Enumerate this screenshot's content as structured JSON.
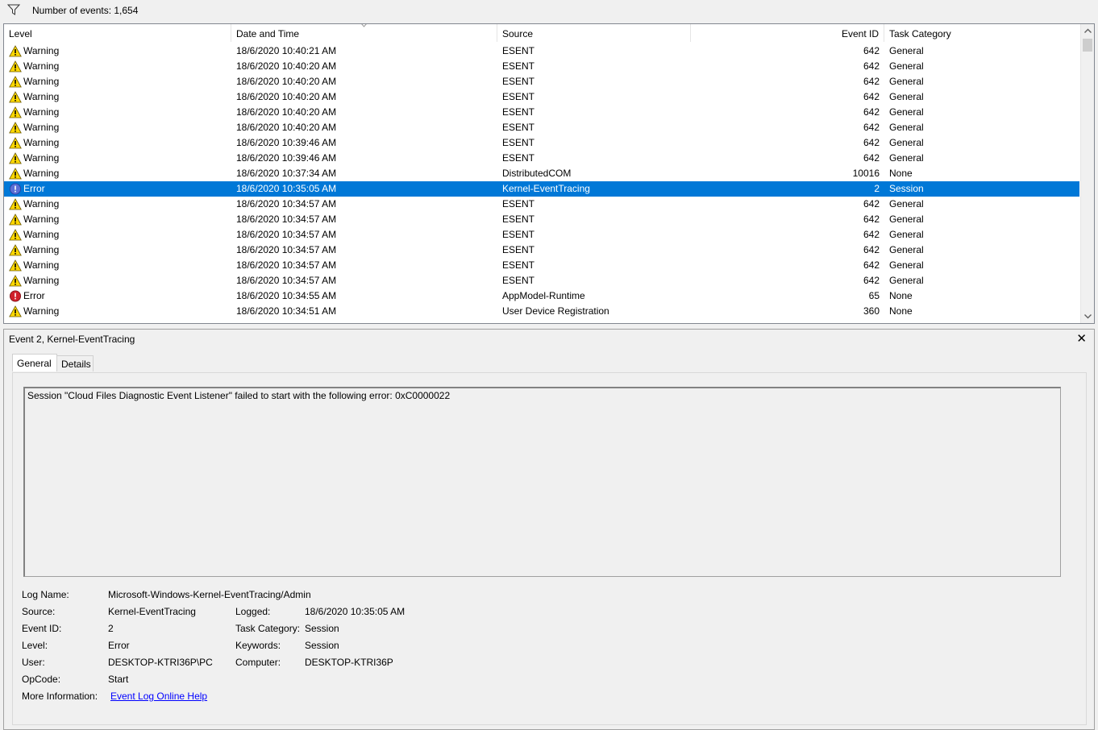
{
  "filter": {
    "count_text": "Number of events: 1,654"
  },
  "columns": {
    "level": "Level",
    "date": "Date and Time",
    "source": "Source",
    "event_id": "Event ID",
    "task_category": "Task Category"
  },
  "events": [
    {
      "level": "Warning",
      "date": "18/6/2020 10:40:21 AM",
      "source": "ESENT",
      "id": "642",
      "cat": "General"
    },
    {
      "level": "Warning",
      "date": "18/6/2020 10:40:20 AM",
      "source": "ESENT",
      "id": "642",
      "cat": "General"
    },
    {
      "level": "Warning",
      "date": "18/6/2020 10:40:20 AM",
      "source": "ESENT",
      "id": "642",
      "cat": "General"
    },
    {
      "level": "Warning",
      "date": "18/6/2020 10:40:20 AM",
      "source": "ESENT",
      "id": "642",
      "cat": "General"
    },
    {
      "level": "Warning",
      "date": "18/6/2020 10:40:20 AM",
      "source": "ESENT",
      "id": "642",
      "cat": "General"
    },
    {
      "level": "Warning",
      "date": "18/6/2020 10:40:20 AM",
      "source": "ESENT",
      "id": "642",
      "cat": "General"
    },
    {
      "level": "Warning",
      "date": "18/6/2020 10:39:46 AM",
      "source": "ESENT",
      "id": "642",
      "cat": "General"
    },
    {
      "level": "Warning",
      "date": "18/6/2020 10:39:46 AM",
      "source": "ESENT",
      "id": "642",
      "cat": "General"
    },
    {
      "level": "Warning",
      "date": "18/6/2020 10:37:34 AM",
      "source": "DistributedCOM",
      "id": "10016",
      "cat": "None"
    },
    {
      "level": "Error",
      "date": "18/6/2020 10:35:05 AM",
      "source": "Kernel-EventTracing",
      "id": "2",
      "cat": "Session",
      "selected": true
    },
    {
      "level": "Warning",
      "date": "18/6/2020 10:34:57 AM",
      "source": "ESENT",
      "id": "642",
      "cat": "General"
    },
    {
      "level": "Warning",
      "date": "18/6/2020 10:34:57 AM",
      "source": "ESENT",
      "id": "642",
      "cat": "General"
    },
    {
      "level": "Warning",
      "date": "18/6/2020 10:34:57 AM",
      "source": "ESENT",
      "id": "642",
      "cat": "General"
    },
    {
      "level": "Warning",
      "date": "18/6/2020 10:34:57 AM",
      "source": "ESENT",
      "id": "642",
      "cat": "General"
    },
    {
      "level": "Warning",
      "date": "18/6/2020 10:34:57 AM",
      "source": "ESENT",
      "id": "642",
      "cat": "General"
    },
    {
      "level": "Warning",
      "date": "18/6/2020 10:34:57 AM",
      "source": "ESENT",
      "id": "642",
      "cat": "General"
    },
    {
      "level": "Error",
      "date": "18/6/2020 10:34:55 AM",
      "source": "AppModel-Runtime",
      "id": "65",
      "cat": "None"
    },
    {
      "level": "Warning",
      "date": "18/6/2020 10:34:51 AM",
      "source": "User Device Registration",
      "id": "360",
      "cat": "None"
    }
  ],
  "detail": {
    "title": "Event 2, Kernel-EventTracing",
    "close": "✕",
    "tabs": {
      "general": "General",
      "details": "Details"
    },
    "message": "Session \"Cloud Files Diagnostic Event Listener\" failed to start with the following error: 0xC0000022",
    "labels": {
      "log_name": "Log Name:",
      "source": "Source:",
      "event_id": "Event ID:",
      "level": "Level:",
      "user": "User:",
      "opcode": "OpCode:",
      "more_info": "More Information:",
      "logged": "Logged:",
      "task_category": "Task Category:",
      "keywords": "Keywords:",
      "computer": "Computer:"
    },
    "values": {
      "log_name": "Microsoft-Windows-Kernel-EventTracing/Admin",
      "source": "Kernel-EventTracing",
      "event_id": "2",
      "level": "Error",
      "user": "DESKTOP-KTRI36P\\PC",
      "opcode": "Start",
      "more_info_link": "Event Log Online Help",
      "logged": "18/6/2020 10:35:05 AM",
      "task_category": "Session",
      "keywords": "Session",
      "computer": "DESKTOP-KTRI36P"
    }
  },
  "colors": {
    "selection": "#0078d7",
    "warning_fill": "#ffd800",
    "error_fill": "#d0202a",
    "link": "#0000ff"
  }
}
